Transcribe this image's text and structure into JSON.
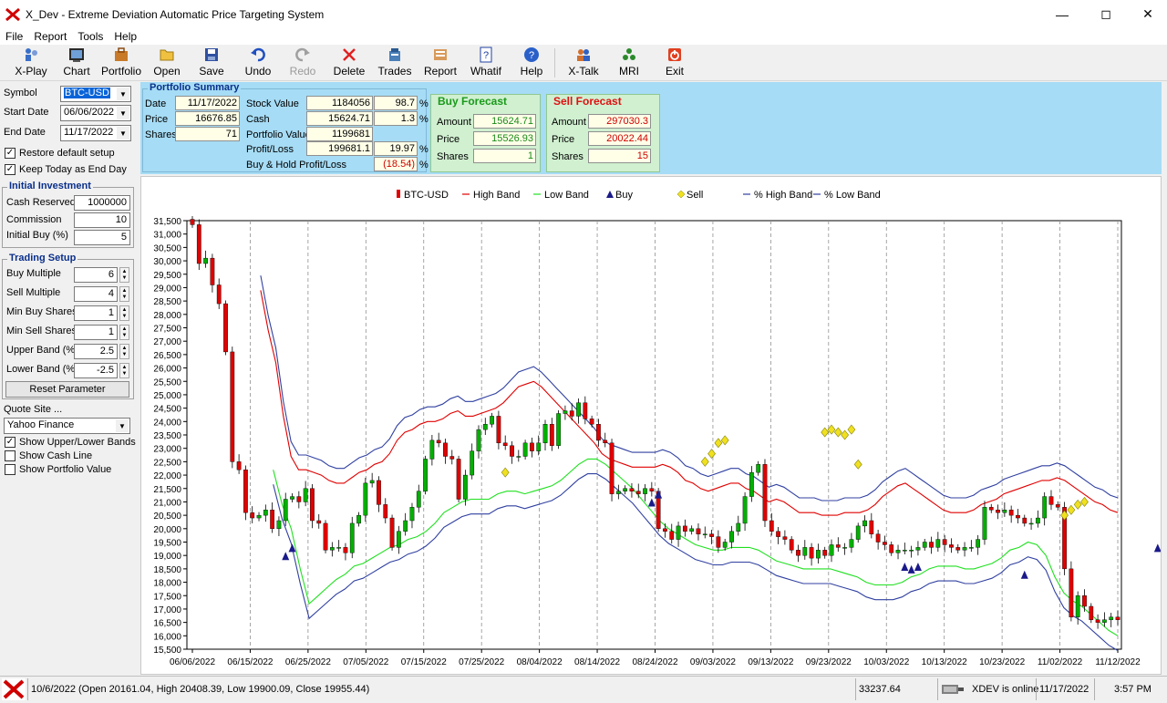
{
  "window": {
    "title": "X_Dev - Extreme Deviation Automatic Price Targeting System"
  },
  "menu": [
    "File",
    "Report",
    "Tools",
    "Help"
  ],
  "toolbar": [
    {
      "label": "X-Play",
      "icon": "xplay-icon",
      "enabled": true
    },
    {
      "label": "Chart",
      "icon": "chart-icon",
      "enabled": true
    },
    {
      "label": "Portfolio",
      "icon": "portfolio-icon",
      "enabled": true
    },
    {
      "label": "Open",
      "icon": "open-icon",
      "enabled": true
    },
    {
      "label": "Save",
      "icon": "save-icon",
      "enabled": true
    },
    {
      "label": "Undo",
      "icon": "undo-icon",
      "enabled": true
    },
    {
      "label": "Redo",
      "icon": "redo-icon",
      "enabled": false
    },
    {
      "label": "Delete",
      "icon": "delete-icon",
      "enabled": true
    },
    {
      "label": "Trades",
      "icon": "trades-icon",
      "enabled": true
    },
    {
      "label": "Report",
      "icon": "report-icon",
      "enabled": true
    },
    {
      "label": "Whatif",
      "icon": "whatif-icon",
      "enabled": true
    },
    {
      "label": "Help",
      "icon": "help-icon",
      "enabled": true
    },
    {
      "label": "X-Talk",
      "icon": "xtalk-icon",
      "enabled": true
    },
    {
      "label": "MRI",
      "icon": "mri-icon",
      "enabled": true
    },
    {
      "label": "Exit",
      "icon": "exit-icon",
      "enabled": true
    }
  ],
  "left": {
    "symbol_label": "Symbol",
    "symbol": "BTC-USD",
    "start_label": "Start Date",
    "start": "06/06/2022",
    "end_label": "End Date",
    "end": "11/17/2022",
    "restore_label": "Restore default setup",
    "restore": true,
    "keep_label": "Keep Today as End Day",
    "keep": true,
    "initial": {
      "title": "Initial Investment",
      "cash_label": "Cash Reserved",
      "cash": "1000000",
      "comm_label": "Commission",
      "comm": "10",
      "buy_label": "Initial Buy (%)",
      "buy": "5"
    },
    "trading": {
      "title": "Trading Setup",
      "rows": [
        {
          "label": "Buy Multiple",
          "value": "6"
        },
        {
          "label": "Sell Multiple",
          "value": "4"
        },
        {
          "label": "Min Buy Shares",
          "value": "1"
        },
        {
          "label": "Min Sell Shares",
          "value": "1"
        },
        {
          "label": "Upper Band (%)",
          "value": "2.5"
        },
        {
          "label": "Lower Band (%)",
          "value": "-2.5"
        }
      ],
      "reset": "Reset Parameter"
    },
    "quote_label": "Quote Site ...",
    "quote": "Yahoo Finance",
    "bands_label": "Show Upper/Lower Bands",
    "bands": true,
    "cashline_label": "Show Cash Line",
    "cashline": false,
    "portval_label": "Show Portfolio Value",
    "portval": false
  },
  "summary": {
    "title": "Portfolio Summary",
    "date_label": "Date",
    "date": "11/17/2022",
    "price_label": "Price",
    "price": "16676.85",
    "shares_label": "Shares",
    "shares": "71",
    "stock_label": "Stock Value",
    "stock": "1184056",
    "stock_pct": "98.7",
    "cash_label": "Cash",
    "cash": "15624.71",
    "cash_pct": "1.3",
    "pv_label": "Portfolio Value",
    "pv": "1199681",
    "pl_label": "Profit/Loss",
    "pl": "199681.1",
    "pl_pct": "19.97",
    "bh_label": "Buy & Hold Profit/Loss",
    "bh_pct": "(18.54)",
    "pct": "%",
    "buy": {
      "title": "Buy Forecast",
      "amount_label": "Amount",
      "amount": "15624.71",
      "price_label": "Price",
      "price": "15526.93",
      "shares_label": "Shares",
      "shares": "1"
    },
    "sell": {
      "title": "Sell Forecast",
      "amount_label": "Amount",
      "amount": "297030.3",
      "price_label": "Price",
      "price": "20022.44",
      "shares_label": "Shares",
      "shares": "15"
    }
  },
  "legend": [
    "BTC-USD",
    "High Band",
    "Low Band",
    "Buy",
    "Sell",
    "% High Band",
    "% Low Band"
  ],
  "colors": {
    "up": "#00b000",
    "down": "#e00000",
    "high": "#e00000",
    "low": "#20e020",
    "pband": "#3040a0",
    "buy": "#1a1a8a",
    "sell": "#f0e020"
  },
  "chart_data": {
    "type": "candlestick",
    "ylim": [
      15500,
      31500
    ],
    "yticks": [
      15500,
      16000,
      16500,
      17000,
      17500,
      18000,
      18500,
      19000,
      19500,
      20000,
      20500,
      21000,
      21500,
      22000,
      22500,
      23000,
      23500,
      24000,
      24500,
      25000,
      25500,
      26000,
      26500,
      27000,
      27500,
      28000,
      28500,
      29000,
      29500,
      30000,
      30500,
      31000,
      31500
    ],
    "xticks": [
      "06/06/2022",
      "06/15/2022",
      "06/25/2022",
      "07/05/2022",
      "07/15/2022",
      "07/25/2022",
      "08/04/2022",
      "08/14/2022",
      "08/24/2022",
      "09/03/2022",
      "09/13/2022",
      "09/23/2022",
      "10/03/2022",
      "10/13/2022",
      "10/23/2022",
      "11/02/2022",
      "11/12/2022"
    ],
    "x_start": "06/06/2022",
    "x_end": "11/17/2022",
    "close": [
      31350,
      29900,
      30100,
      29100,
      28400,
      26600,
      22500,
      22200,
      20600,
      20400,
      20500,
      20700,
      20000,
      20300,
      21100,
      21200,
      21000,
      21500,
      20300,
      20200,
      19200,
      19300,
      19300,
      19100,
      20200,
      20500,
      21700,
      21800,
      20900,
      20400,
      19300,
      19900,
      20300,
      20800,
      21400,
      22600,
      23300,
      23200,
      22700,
      22600,
      21100,
      22000,
      22900,
      23700,
      23900,
      24200,
      23200,
      23100,
      22700,
      22700,
      23200,
      22900,
      23200,
      23900,
      23100,
      24300,
      24400,
      24200,
      24700,
      24100,
      23900,
      23300,
      23200,
      21300,
      21400,
      21500,
      21400,
      21300,
      21500,
      21400,
      20000,
      19900,
      19600,
      20100,
      19900,
      20000,
      19800,
      19800,
      19700,
      19300,
      19500,
      19900,
      20200,
      21200,
      22100,
      22400,
      20300,
      19900,
      19700,
      19600,
      19200,
      19000,
      19300,
      18900,
      19200,
      19000,
      19400,
      19300,
      19300,
      19600,
      20100,
      20300,
      19800,
      19500,
      19400,
      19100,
      19200,
      19200,
      19200,
      19300,
      19500,
      19300,
      19600,
      19400,
      19300,
      19200,
      19300,
      19300,
      19600,
      20800,
      20700,
      20600,
      20700,
      20500,
      20400,
      20200,
      20200,
      20400,
      21200,
      20900,
      20800,
      18500,
      16700,
      17500,
      17100,
      16600,
      16500,
      16600,
      16700,
      16600
    ],
    "high_band": [
      null,
      null,
      null,
      null,
      null,
      null,
      null,
      null,
      null,
      28900,
      27400,
      26200,
      24200,
      22700,
      22200,
      22200,
      22100,
      22000,
      21800,
      21700,
      21700,
      21900,
      22100,
      22200,
      22400,
      22500,
      22800,
      23300,
      23600,
      23700,
      23900,
      24000,
      24000,
      24100,
      24300,
      24400,
      24200,
      24200,
      24300,
      24400,
      24500,
      24700,
      25000,
      25300,
      25400,
      25500,
      25300,
      25000,
      24700,
      24400,
      24100,
      23800,
      23500,
      23200,
      22800,
      22600,
      22500,
      22400,
      22300,
      22300,
      22300,
      22300,
      22400,
      22300,
      22100,
      21800,
      21700,
      21500,
      21400,
      21500,
      21600,
      21700,
      21700,
      21500,
      21400,
      21200,
      21000,
      21100,
      21000,
      20800,
      20600,
      20600,
      20600,
      20500,
      20500,
      20500,
      20600,
      20600,
      20600,
      20700,
      20900,
      21200,
      21400,
      21600,
      21700,
      21500,
      21300,
      21100,
      20900,
      20700,
      20600,
      20600,
      20600,
      20700,
      20900,
      21000,
      21100,
      21300,
      21400,
      21500,
      21600,
      21700,
      21800,
      21800,
      21900,
      21800,
      21600,
      21400,
      21200,
      21000,
      20900,
      20700,
      20600
    ],
    "low_band": [
      null,
      null,
      null,
      null,
      null,
      null,
      null,
      null,
      null,
      22200,
      20900,
      20000,
      18500,
      17200,
      17500,
      17800,
      18100,
      18300,
      18600,
      18700,
      18900,
      19100,
      19300,
      19400,
      19600,
      19700,
      19900,
      20200,
      20600,
      20800,
      21000,
      21100,
      21100,
      21100,
      21300,
      21400,
      21400,
      21300,
      21400,
      21500,
      21600,
      21800,
      22100,
      22400,
      22600,
      22600,
      22400,
      22100,
      21800,
      21500,
      21100,
      20700,
      20300,
      20000,
      19800,
      19600,
      19400,
      19300,
      19200,
      19200,
      19300,
      19300,
      19300,
      19200,
      19000,
      18800,
      18700,
      18600,
      18500,
      18500,
      18500,
      18500,
      18400,
      18300,
      18200,
      18000,
      17900,
      17900,
      17900,
      18000,
      18200,
      18300,
      18500,
      18600,
      18600,
      18600,
      18500,
      18500,
      18600,
      18700,
      18900,
      19200,
      19300,
      19500,
      19400,
      19000,
      18200,
      17600,
      17300,
      17100,
      16800,
      16500,
      16200,
      16000
    ],
    "buys": [
      [
        14,
        19000
      ],
      [
        15,
        19300
      ],
      [
        69,
        21000
      ],
      [
        70,
        21300
      ],
      [
        107,
        18600
      ],
      [
        108,
        18500
      ],
      [
        109,
        18600
      ],
      [
        125,
        18300
      ],
      [
        145,
        19300
      ],
      [
        147,
        18500
      ],
      [
        152,
        16900
      ]
    ],
    "sells": [
      [
        47,
        22100
      ],
      [
        77,
        22500
      ],
      [
        78,
        22800
      ],
      [
        79,
        23200
      ],
      [
        80,
        23300
      ],
      [
        95,
        23600
      ],
      [
        96,
        23700
      ],
      [
        97,
        23600
      ],
      [
        98,
        23500
      ],
      [
        99,
        23700
      ],
      [
        100,
        22400
      ],
      [
        131,
        20500
      ],
      [
        132,
        20700
      ],
      [
        133,
        20900
      ],
      [
        134,
        21000
      ]
    ]
  },
  "status": {
    "candle": "10/6/2022 (Open 20161.04, High 20408.39, Low 19900.09, Close 19955.44)",
    "value": "33237.64",
    "online": "XDEV is online",
    "date": "11/17/2022",
    "time": "3:57 PM"
  }
}
